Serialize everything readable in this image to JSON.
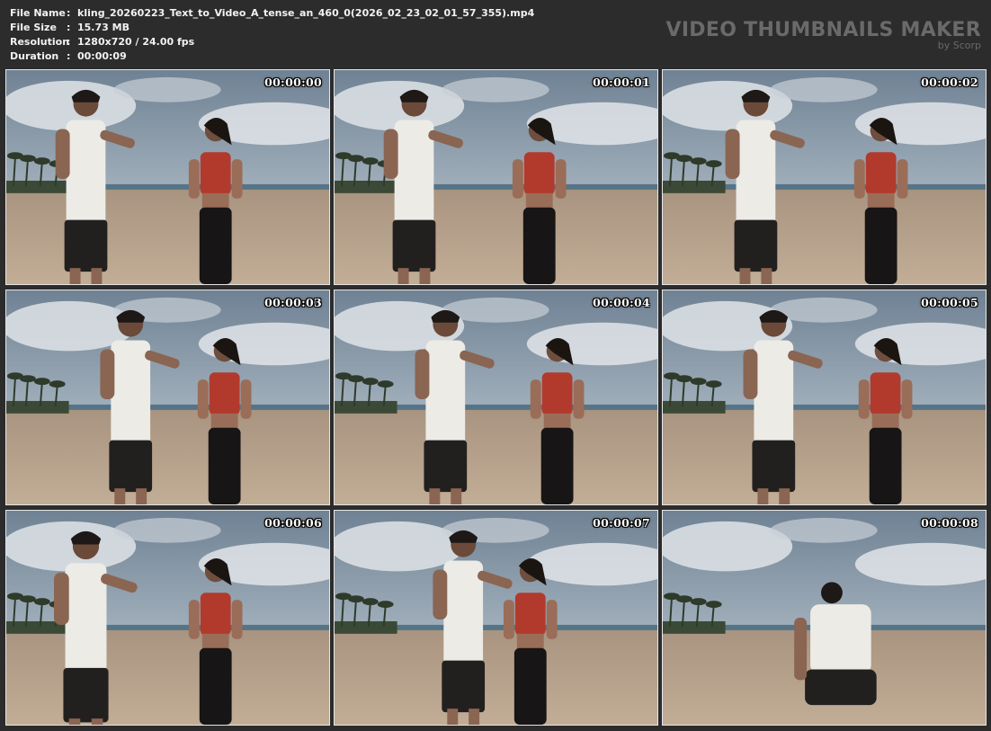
{
  "header": {
    "rows": [
      {
        "label": "File Name",
        "sep": ":",
        "value": "kling_20260223_Text_to_Video_A_tense_an_460_0(2026_02_23_02_01_57_355).mp4"
      },
      {
        "label": "File Size",
        "sep": ":",
        "value": "15.73 MB"
      },
      {
        "label": "Resolution",
        "sep": ":",
        "value": "1280x720 / 24.00 fps"
      },
      {
        "label": "Duration",
        "sep": ":",
        "value": "00:00:09"
      }
    ]
  },
  "brand": {
    "title": "VIDEO THUMBNAILS MAKER",
    "subtitle": "by Scorp"
  },
  "thumbnails": [
    {
      "timecode": "00:00:00"
    },
    {
      "timecode": "00:00:01"
    },
    {
      "timecode": "00:00:02"
    },
    {
      "timecode": "00:00:03"
    },
    {
      "timecode": "00:00:04"
    },
    {
      "timecode": "00:00:05"
    },
    {
      "timecode": "00:00:06"
    },
    {
      "timecode": "00:00:07"
    },
    {
      "timecode": "00:00:08"
    }
  ],
  "colors": {
    "background": "#2c2c2c",
    "header_text": "#f2f2f2",
    "brand_text": "#6a6a6a",
    "thumb_border": "#e6e6e6"
  }
}
